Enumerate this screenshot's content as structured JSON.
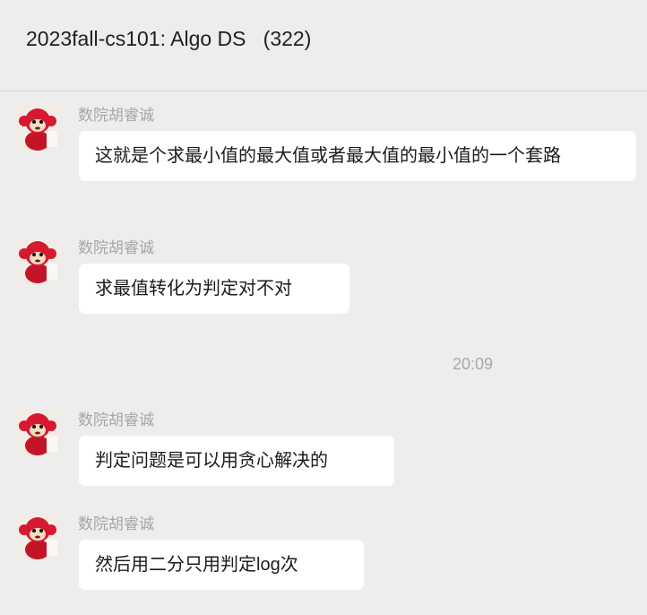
{
  "header": {
    "title": "2023fall-cs101: Algo DS   (322)"
  },
  "timestamp": "20:09",
  "messages": [
    {
      "sender": "数院胡睿诚",
      "text": "这就是个求最小值的最大值或者最大值的最小值的一个套路"
    },
    {
      "sender": "数院胡睿诚",
      "text": "求最值转化为判定对不对"
    },
    {
      "sender": "数院胡睿诚",
      "text": "判定问题是可以用贪心解决的"
    },
    {
      "sender": "数院胡睿诚",
      "text": "然后用二分只用判定log次"
    }
  ],
  "colors": {
    "background": "#ededed",
    "bubble": "#ffffff",
    "sender_text": "#a6a6a6",
    "avatar_monkey": "#d7192f"
  },
  "icons": {
    "avatar": "red-monkey-plush-avatar"
  }
}
